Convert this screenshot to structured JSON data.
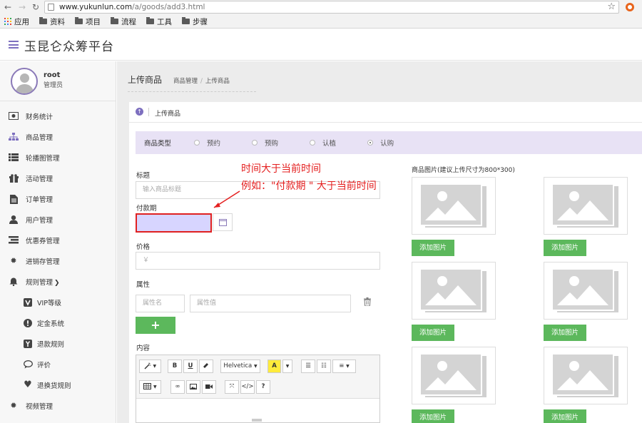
{
  "browser": {
    "url_host": "www.yukunlun.com",
    "url_path": "/a/goods/add3.html",
    "bookmarks": [
      "应用",
      "资料",
      "项目",
      "流程",
      "工具",
      "步骤"
    ]
  },
  "header": {
    "title": "玉昆仑众筹平台",
    "accent": "#7d6fbf"
  },
  "user": {
    "name": "root",
    "role": "管理员"
  },
  "sidebar": {
    "items": [
      {
        "label": "财务统计",
        "icon": "money-icon"
      },
      {
        "label": "商品管理",
        "icon": "sitemap-icon"
      },
      {
        "label": "轮播图管理",
        "icon": "list-icon"
      },
      {
        "label": "活动管理",
        "icon": "gift-icon"
      },
      {
        "label": "订单管理",
        "icon": "document-icon"
      },
      {
        "label": "用户管理",
        "icon": "user-icon"
      },
      {
        "label": "优惠券管理",
        "icon": "tasks-icon"
      },
      {
        "label": "进销存管理",
        "icon": "cog-icon"
      },
      {
        "label": "规则管理",
        "icon": "bell-icon"
      },
      {
        "label": "VIP等级",
        "icon": "vip-icon"
      },
      {
        "label": "定金系统",
        "icon": "exclamation-icon"
      },
      {
        "label": "退款规则",
        "icon": "yen-icon"
      },
      {
        "label": "评价",
        "icon": "comment-icon"
      },
      {
        "label": "退换货规则",
        "icon": "heart-icon"
      },
      {
        "label": "视频管理",
        "icon": "cog-icon"
      }
    ]
  },
  "page": {
    "title": "上传商品",
    "breadcrumb": [
      "商品管理",
      "上传商品"
    ],
    "panel_title": "上传商品"
  },
  "form": {
    "type_label": "商品类型",
    "types": [
      "预约",
      "预购",
      "认植",
      "认购"
    ],
    "selected_type": "认购",
    "title_label": "标题",
    "title_placeholder": "输入商品标题",
    "payment_label": "付款期",
    "price_label": "价格",
    "price_prefix": "￥",
    "attr_label": "属性",
    "attr_name_placeholder": "属性名",
    "attr_value_placeholder": "属性值",
    "add_button": "+",
    "content_label": "内容",
    "font_name": "Helvetica",
    "editor_tools": [
      "A",
      "B",
      "U",
      "?"
    ]
  },
  "images": {
    "title": "商品图片(建议上传尺寸为800*300)",
    "add_label": "添加图片"
  },
  "annotation": {
    "line1": "时间大于当前时间",
    "line2": "例如：\"付款期 \" 大于当前时间",
    "color": "#e41f1f"
  }
}
